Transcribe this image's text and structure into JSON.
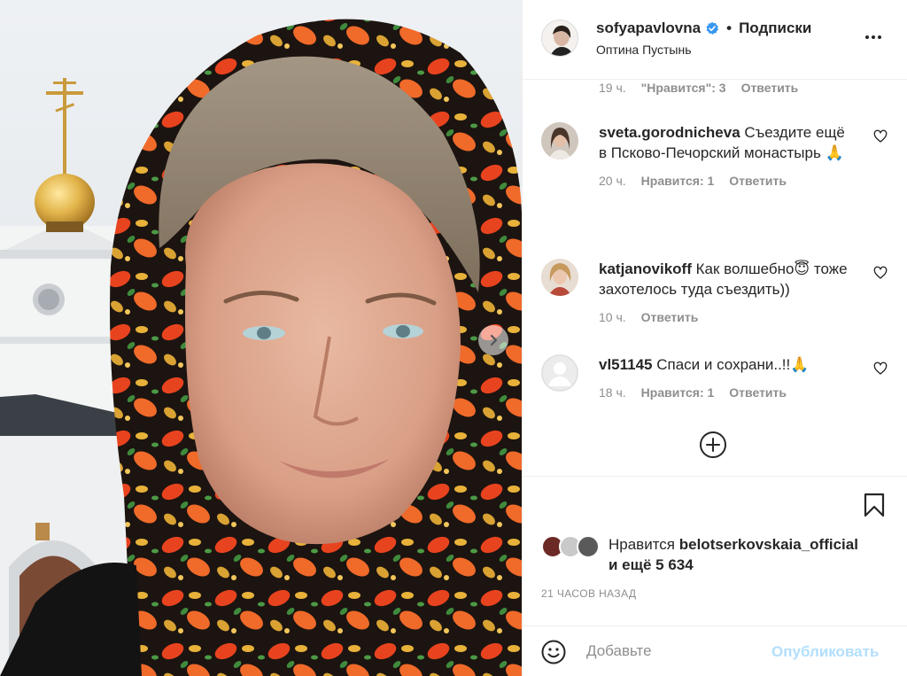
{
  "post": {
    "author": "sofyapavlovna",
    "dot": "•",
    "follow_label": "Подписки",
    "location": "Оптина Пустынь"
  },
  "comments_top_meta": {
    "time": "19 ч.",
    "likes": "\"Нравится\": 3",
    "reply": "Ответить"
  },
  "comments": [
    {
      "user": "sveta.gorodnicheva",
      "text": " Съездите ещё в Псково-Печорский монастырь 🙏",
      "time": "20 ч.",
      "likes": "Нравится: 1",
      "reply": "Ответить"
    },
    {
      "user": "katjanovikoff",
      "text": " Как волшебно😇 тоже захотелось туда съездить))",
      "time": "10 ч.",
      "likes": "",
      "reply": "Ответить"
    },
    {
      "user": "vl51145",
      "text": " Спаси и сохрани..!!🙏",
      "time": "18 ч.",
      "likes": "Нравится: 1",
      "reply": "Ответить"
    }
  ],
  "likes_section": {
    "prefix": "Нравится ",
    "user": "belotserkovskaia_official",
    "suffix": "и ещё 5 634"
  },
  "time_ago": "21 ЧАСОВ НАЗАД",
  "comment_box": {
    "placeholder": "Добавьте",
    "publish_label": "Опубликовать"
  },
  "colors": {
    "verified": "#3897f0",
    "publish_disabled": "#b2dffc",
    "muted": "#8e8e8e"
  }
}
